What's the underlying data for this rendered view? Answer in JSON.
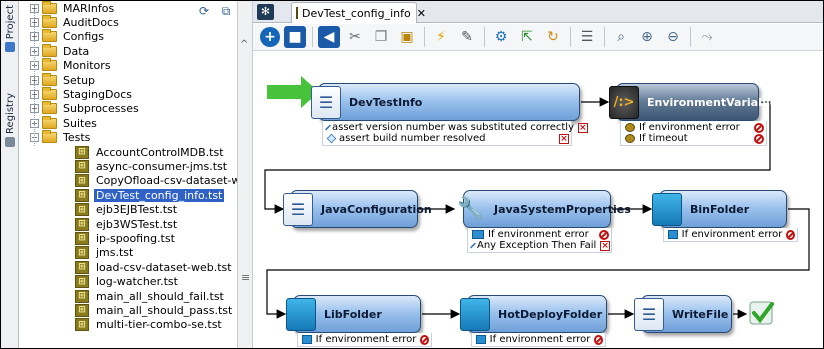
{
  "left_tabs": [
    {
      "label": "Project",
      "icon": "project-icon",
      "color": "#3c77c9"
    },
    {
      "label": "Registry",
      "icon": "registry-icon",
      "color": "#7a8a99"
    }
  ],
  "tree": {
    "toolbar_icons": [
      "refresh-icon",
      "new-window-icon",
      "collapse-left-icon"
    ],
    "items": [
      {
        "label": "MARInfos",
        "type": "folder",
        "expander": "+"
      },
      {
        "label": "AuditDocs",
        "type": "folder",
        "expander": "+"
      },
      {
        "label": "Configs",
        "type": "folder",
        "expander": "+"
      },
      {
        "label": "Data",
        "type": "folder",
        "expander": "+"
      },
      {
        "label": "Monitors",
        "type": "folder",
        "expander": "+"
      },
      {
        "label": "Setup",
        "type": "folder",
        "expander": "+"
      },
      {
        "label": "StagingDocs",
        "type": "folder",
        "expander": "+"
      },
      {
        "label": "Subprocesses",
        "type": "folder",
        "expander": "+"
      },
      {
        "label": "Suites",
        "type": "folder",
        "expander": "+"
      },
      {
        "label": "Tests",
        "type": "folder",
        "expander": "−"
      },
      {
        "label": "AccountControlMDB.tst",
        "type": "test"
      },
      {
        "label": "async-consumer-jms.tst",
        "type": "test"
      },
      {
        "label": "CopyOfload-csv-dataset-web.tst",
        "type": "test"
      },
      {
        "label": "DevTest_config_info.tst",
        "type": "test",
        "selected": true
      },
      {
        "label": "ejb3EJBTest.tst",
        "type": "test"
      },
      {
        "label": "ejb3WSTest.tst",
        "type": "test"
      },
      {
        "label": "ip-spoofing.tst",
        "type": "test"
      },
      {
        "label": "jms.tst",
        "type": "test"
      },
      {
        "label": "load-csv-dataset-web.tst",
        "type": "test"
      },
      {
        "label": "log-watcher.tst",
        "type": "test"
      },
      {
        "label": "main_all_should_fail.tst",
        "type": "test"
      },
      {
        "label": "main_all_should_pass.tst",
        "type": "test"
      },
      {
        "label": "multi-tier-combo-se.tst",
        "type": "test"
      }
    ]
  },
  "editor": {
    "tab_label": "DevTest_config_info",
    "tab_close": "✕",
    "toolbar_icons": [
      "add-step-icon",
      "save-icon",
      "back-icon",
      "cut-icon",
      "copy-icon",
      "paste-icon",
      "run-icon",
      "edit-icon",
      "settings-icon",
      "export-icon",
      "replay-icon",
      "list-icon",
      "search-icon",
      "zoom-in-icon",
      "zoom-out-icon",
      "fit-icon"
    ]
  },
  "flow": {
    "nodes": [
      {
        "id": "devtestinfo",
        "label": "DevTestInfo",
        "icon": "document-icon",
        "style": "light",
        "rows": [
          {
            "text": "assert version number was substituted correctly",
            "kind": "assert",
            "action": "x"
          },
          {
            "text": "assert build number resolved",
            "kind": "assert",
            "action": "x"
          }
        ]
      },
      {
        "id": "envvars",
        "label": "EnvironmentVariables",
        "icon": "env-icon",
        "style": "dark",
        "rows": [
          {
            "text": "If environment error",
            "kind": "event",
            "action": "no"
          },
          {
            "text": "If timeout",
            "kind": "event",
            "action": "no"
          }
        ]
      },
      {
        "id": "javaconfig",
        "label": "JavaConfiguration",
        "icon": "document-icon",
        "style": "light",
        "rows": []
      },
      {
        "id": "javasysprops",
        "label": "JavaSystemProperties",
        "icon": "tool-icon",
        "style": "light",
        "rows": [
          {
            "text": "If environment error",
            "kind": "file",
            "action": "no"
          },
          {
            "text": "Any Exception Then Fail",
            "kind": "assert",
            "action": "x"
          }
        ]
      },
      {
        "id": "binfolder",
        "label": "BinFolder",
        "icon": "folder-icon",
        "style": "light",
        "rows": [
          {
            "text": "If environment error",
            "kind": "file",
            "action": "no"
          }
        ]
      },
      {
        "id": "libfolder",
        "label": "LibFolder",
        "icon": "folder-icon",
        "style": "light",
        "rows": [
          {
            "text": "If environment error",
            "kind": "file",
            "action": "no"
          }
        ]
      },
      {
        "id": "hotdeploy",
        "label": "HotDeployFolder",
        "icon": "folder-icon",
        "style": "light",
        "rows": [
          {
            "text": "If environment error",
            "kind": "file",
            "action": "no"
          }
        ]
      },
      {
        "id": "writefile",
        "label": "WriteFile",
        "icon": "document-icon",
        "style": "light",
        "rows": []
      }
    ],
    "end_icon": "checkmark-icon",
    "colors": {
      "start_arrow": "#46c33a",
      "end_check": "#2fa52b",
      "node_border": "#274a74"
    }
  }
}
